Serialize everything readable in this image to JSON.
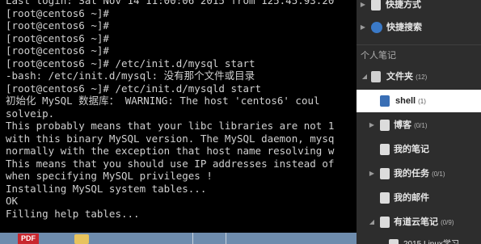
{
  "terminal": {
    "lines": [
      "Last login: Sat Nov 14 11:00:06 2015 from 125.45.93.20",
      "[root@centos6 ~]#",
      "[root@centos6 ~]#",
      "[root@centos6 ~]#",
      "[root@centos6 ~]#",
      "[root@centos6 ~]# /etc/init.d/mysql start",
      "-bash: /etc/init.d/mysql: 没有那个文件或目录",
      "[root@centos6 ~]# /etc/init.d/mysqld start",
      "初始化 MySQL 数据库： WARNING: The host 'centos6' coul",
      "solveip.",
      "This probably means that your libc libraries are not 1",
      "with this binary MySQL version. The MySQL daemon, mysq",
      "normally with the exception that host name resolving w",
      "This means that you should use IP addresses instead of",
      "when specifying MySQL privileges !",
      "Installing MySQL system tables...",
      "OK",
      "Filling help tables..."
    ]
  },
  "taskbar": {
    "pdf_label": "PDF"
  },
  "sidebar": {
    "shortcuts_label": "快捷方式",
    "quick_search_label": "快捷搜索",
    "section_label": "个人笔记",
    "folders_label": "文件夹",
    "folders_count": "(12)",
    "shell_label": "shell",
    "shell_count": "(1)",
    "blog_label": "博客",
    "blog_count": "(0/1)",
    "my_notes_label": "我的笔记",
    "tasks_label": "我的任务",
    "tasks_count": "(0/1)",
    "mail_label": "我的邮件",
    "cloud_label": "有道云笔记",
    "cloud_count": "(0/9)",
    "partial_item_label": "2015 Linux学习"
  }
}
